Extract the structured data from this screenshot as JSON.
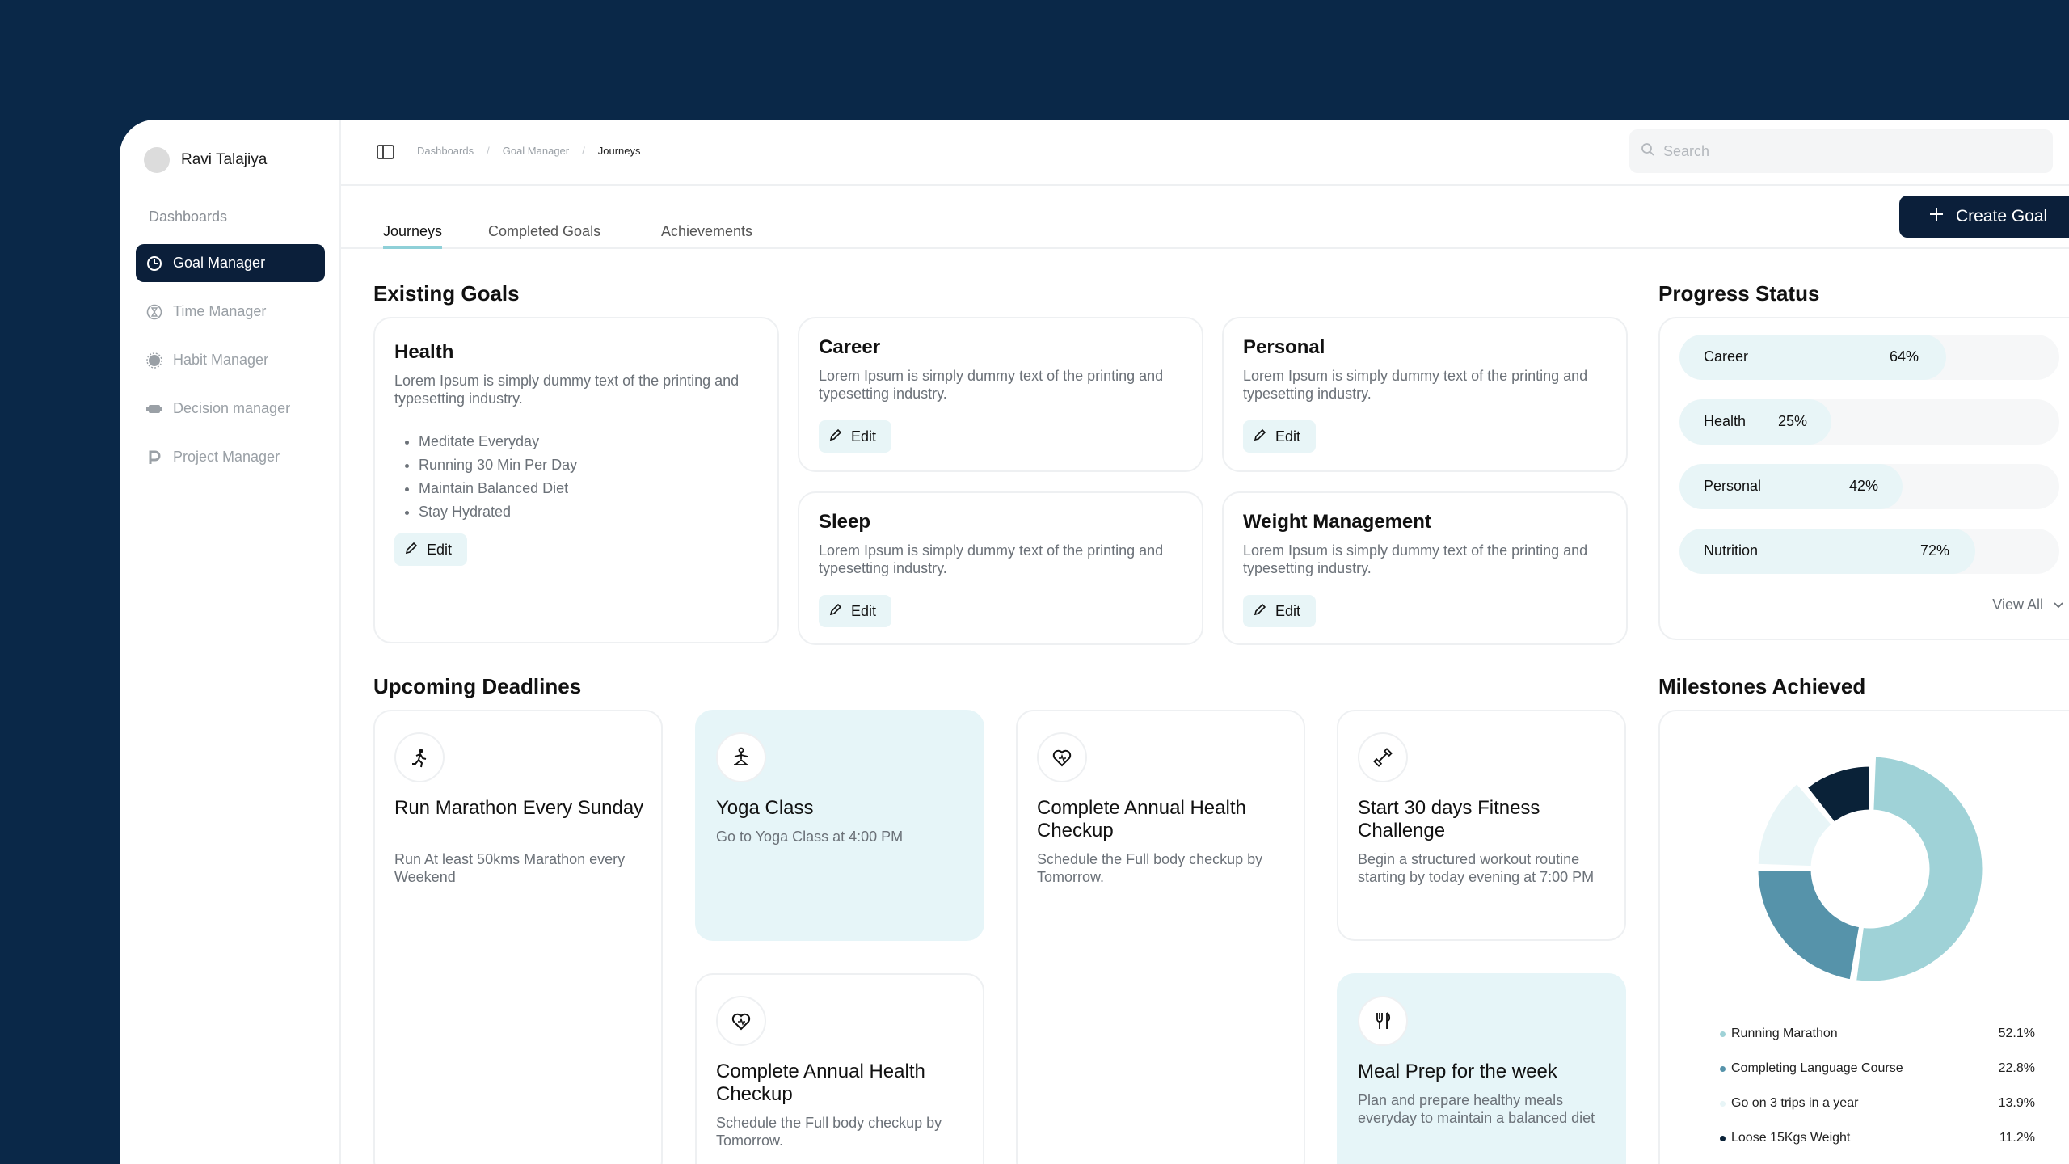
{
  "user": {
    "name": "Ravi Talajiya"
  },
  "sidebar": {
    "section_label": "Dashboards",
    "items": [
      {
        "label": "Goal Manager",
        "icon": "goal-icon",
        "active": true
      },
      {
        "label": "Time Manager",
        "icon": "hourglass-icon",
        "active": false
      },
      {
        "label": "Habit Manager",
        "icon": "habit-icon",
        "active": false
      },
      {
        "label": "Decision manager",
        "icon": "decision-icon",
        "active": false
      },
      {
        "label": "Project Manager",
        "icon": "project-icon",
        "active": false
      }
    ]
  },
  "breadcrumb": [
    "Dashboards",
    "Goal Manager",
    "Journeys"
  ],
  "search": {
    "placeholder": "Search",
    "value": ""
  },
  "tabs": [
    "Journeys",
    "Completed Goals",
    "Achievements"
  ],
  "create_button": "Create Goal",
  "existing_goals": {
    "title": "Existing Goals",
    "edit_label": "Edit",
    "cards": [
      {
        "title": "Health",
        "desc": "Lorem Ipsum is simply dummy text of the printing and typesetting industry.",
        "bullets": [
          "Meditate Everyday",
          "Running 30 Min Per Day",
          "Maintain Balanced Diet",
          "Stay Hydrated"
        ]
      },
      {
        "title": "Career",
        "desc": "Lorem Ipsum is simply dummy text of the printing and typesetting industry."
      },
      {
        "title": "Personal",
        "desc": "Lorem Ipsum is simply dummy text of the printing and typesetting industry."
      },
      {
        "title": "Sleep",
        "desc": "Lorem Ipsum is simply dummy text of the printing and typesetting industry."
      },
      {
        "title": "Weight Management",
        "desc": "Lorem Ipsum is simply dummy text of the printing and typesetting industry."
      }
    ]
  },
  "progress_status": {
    "title": "Progress Status",
    "rows": [
      {
        "label": "Career",
        "pct": "64%",
        "value": 0.64
      },
      {
        "label": "Health",
        "pct": "25%",
        "value": 0.25
      },
      {
        "label": "Personal",
        "pct": "42%",
        "value": 0.42
      },
      {
        "label": "Nutrition",
        "pct": "72%",
        "value": 0.72
      }
    ],
    "view_all": "View All"
  },
  "upcoming_deadlines": {
    "title": "Upcoming Deadlines",
    "cards": [
      {
        "title": "Run Marathon Every Sunday",
        "desc": "Run At least 50kms Marathon every Weekend",
        "icon": "running-icon"
      },
      {
        "title": "Yoga Class",
        "desc": "Go to Yoga Class at 4:00 PM",
        "icon": "yoga-icon"
      },
      {
        "title": "Complete Annual Health Checkup",
        "desc": "Schedule the Full body checkup by Tomorrow.",
        "icon": "heart-icon"
      },
      {
        "title": "Start 30 days Fitness Challenge",
        "desc": "Begin a structured workout routine starting by today evening at 7:00 PM",
        "icon": "dumbbell-icon"
      },
      {
        "title": "Complete Annual Health Checkup",
        "desc": "Schedule the Full body checkup by Tomorrow.",
        "icon": "heart-icon"
      },
      {
        "title": "Meal Prep for the week",
        "desc": "Plan and prepare healthy meals everyday to maintain a balanced diet",
        "icon": "utensils-icon"
      }
    ]
  },
  "milestones": {
    "title": "Milestones Achieved",
    "colors": {
      "running": "#9fd2d7",
      "language": "#5693aa",
      "trips": "#e8f5f7",
      "weight": "#0a2238"
    }
  },
  "chart_data": {
    "type": "pie",
    "categories": [
      "Running Marathon",
      "Completing Language Course",
      "Go on 3 trips in a year",
      "Loose 15Kgs Weight"
    ],
    "values": [
      52.1,
      22.8,
      13.9,
      11.2
    ],
    "labels": [
      "52.1%",
      "22.8%",
      "13.9%",
      "11.2%"
    ],
    "title": "",
    "legend": "bottom"
  }
}
